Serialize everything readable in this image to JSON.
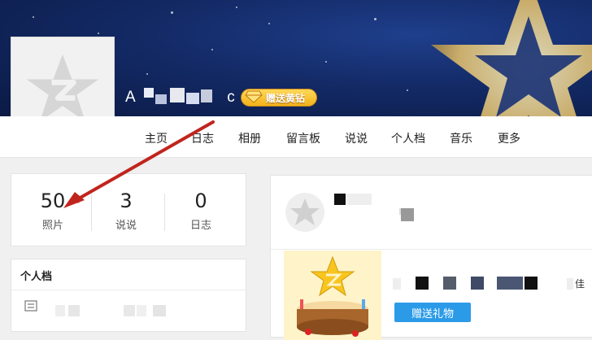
{
  "header": {
    "username_visible": "A",
    "username_tail": "c",
    "gift_diamond_label": "赠送黄钻"
  },
  "nav": {
    "items": [
      "主页",
      "日志",
      "相册",
      "留言板",
      "说说",
      "个人档",
      "音乐",
      "更多"
    ]
  },
  "stats": {
    "photos": {
      "value": "50",
      "label": "照片"
    },
    "moods": {
      "value": "3",
      "label": "说说"
    },
    "blogs": {
      "value": "0",
      "label": "日志"
    }
  },
  "profile": {
    "title": "个人档"
  },
  "feed": {
    "send_gift_label": "赠送礼物",
    "truncated_text": "佳"
  },
  "colors": {
    "banner": "#132a66",
    "accent_blue": "#2b9be8",
    "gold": "#f2b219",
    "arrow": "#c0251d"
  },
  "icons": {
    "avatar": "qzone-star-logo",
    "diamond": "yellow-diamond-icon",
    "profile_doc": "document-icon",
    "annotation": "red-arrow"
  }
}
